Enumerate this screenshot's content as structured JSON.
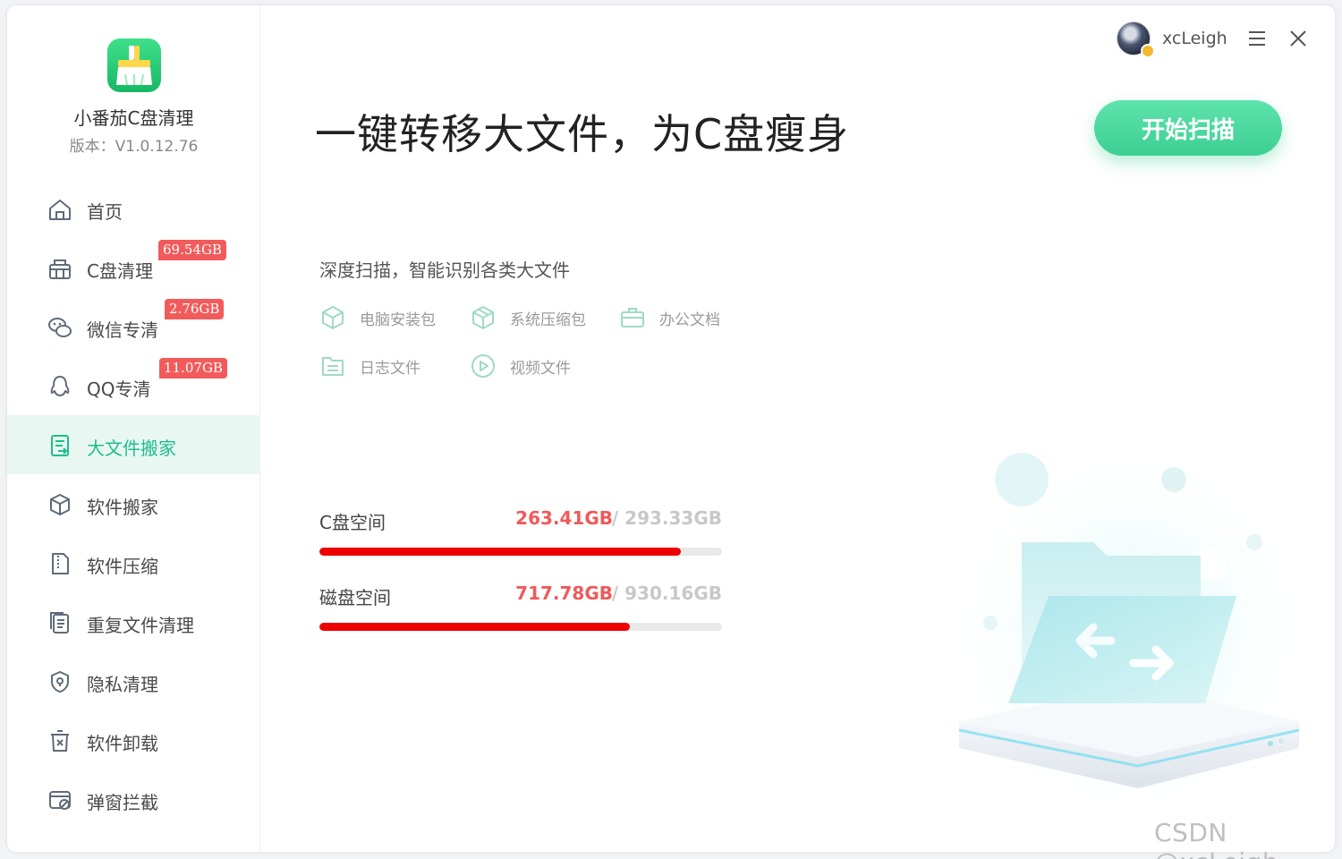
{
  "app": {
    "name": "小番茄C盘清理",
    "version": "版本：V1.0.12.76"
  },
  "sidebar": {
    "items": [
      {
        "label": "首页",
        "icon": "home-icon",
        "badge": null
      },
      {
        "label": "C盘清理",
        "icon": "basket-icon",
        "badge": "69.54GB"
      },
      {
        "label": "微信专清",
        "icon": "wechat-icon",
        "badge": "2.76GB"
      },
      {
        "label": "QQ专清",
        "icon": "qq-icon",
        "badge": "11.07GB"
      },
      {
        "label": "大文件搬家",
        "icon": "big-file-icon",
        "badge": null,
        "active": true
      },
      {
        "label": "软件搬家",
        "icon": "box-move-icon",
        "badge": null
      },
      {
        "label": "软件压缩",
        "icon": "zip-file-icon",
        "badge": null
      },
      {
        "label": "重复文件清理",
        "icon": "duplicate-file-icon",
        "badge": null
      },
      {
        "label": "隐私清理",
        "icon": "shield-icon",
        "badge": null
      },
      {
        "label": "软件卸载",
        "icon": "uninstall-icon",
        "badge": null
      },
      {
        "label": "弹窗拦截",
        "icon": "popup-block-icon",
        "badge": null
      }
    ]
  },
  "user": {
    "name": "xcLeigh"
  },
  "main": {
    "headline": "一键转移大文件，为C盘瘦身",
    "scan_button": "开始扫描",
    "subtitle": "深度扫描，智能识别各类大文件",
    "file_types": [
      "电脑安装包",
      "系统压缩包",
      "办公文档",
      "日志文件",
      "视频文件"
    ],
    "disks": [
      {
        "label": "C盘空间",
        "used": "263.41GB",
        "total": " / 293.33GB",
        "ratio": 0.898
      },
      {
        "label": "磁盘空间",
        "used": "717.78GB",
        "total": " / 930.16GB",
        "ratio": 0.772
      }
    ]
  },
  "colors": {
    "accent": "#1fbd8b",
    "badge": "#f25b5b",
    "bar": "#ee0000"
  },
  "watermark": "CSDN @xcLeigh"
}
